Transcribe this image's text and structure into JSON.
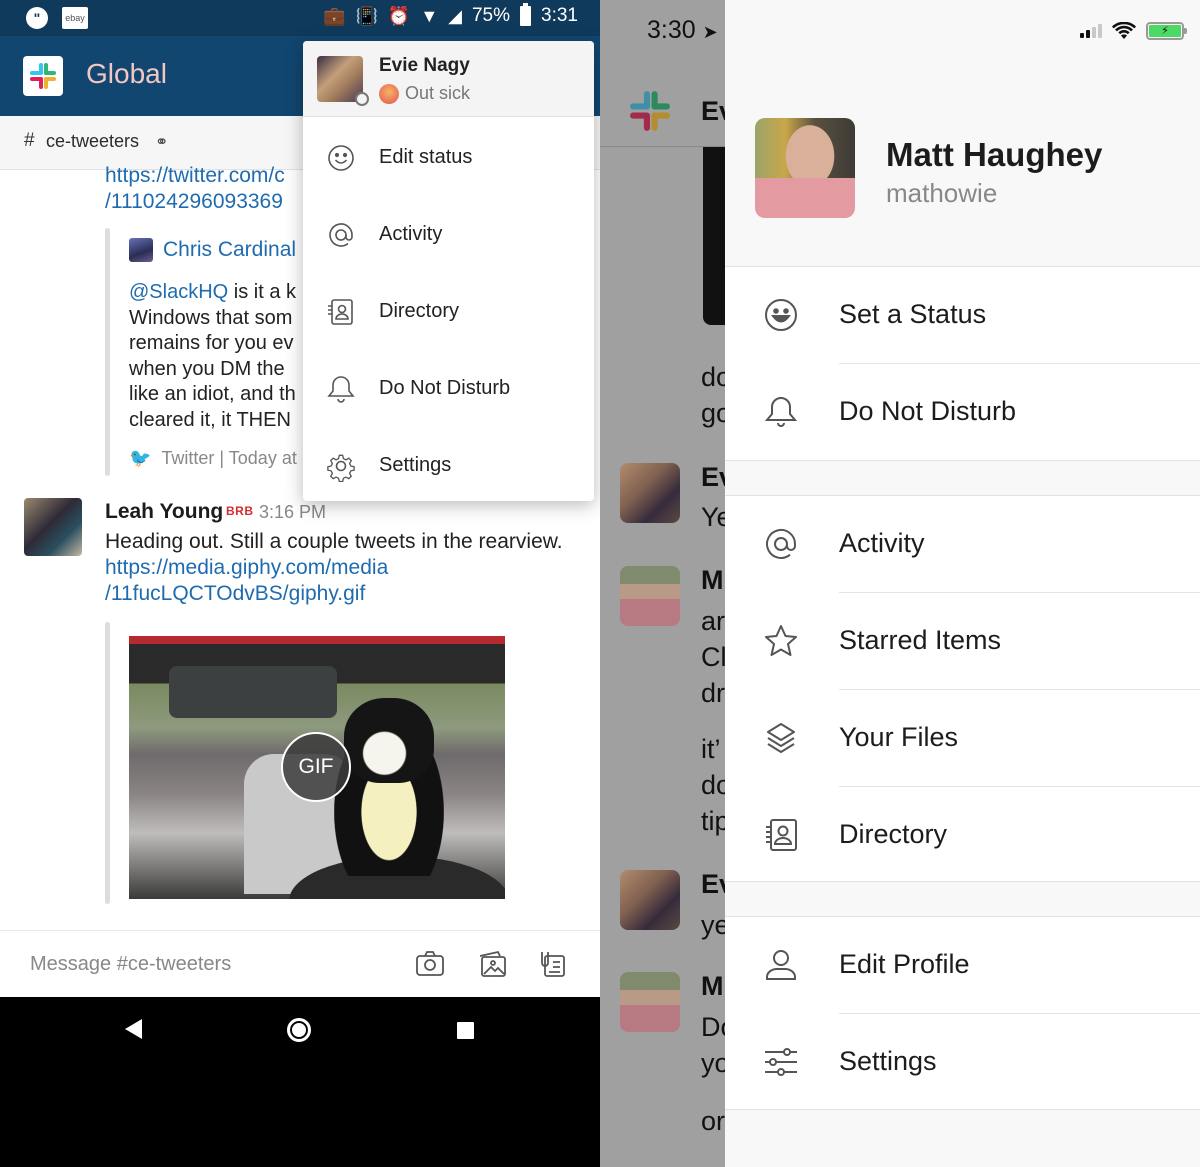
{
  "android": {
    "status_bar": {
      "left_icons": [
        "hangouts-icon",
        "ebay-icon"
      ],
      "ebay_label": "ebay",
      "battery": "75%",
      "time": "3:31",
      "icons": [
        "briefcase-icon",
        "vibrate-icon",
        "alarm-icon",
        "wifi-icon",
        "signal-icon",
        "battery-icon"
      ]
    },
    "header": {
      "workspace": "Global"
    },
    "channel": {
      "hash": "#",
      "name": "ce-tweeters",
      "shared_icon": "⚭"
    },
    "messages": {
      "link_line_1": "https://twitter.com/c",
      "link_line_2": "/111024296093369",
      "tweet": {
        "author": "Chris Cardinal",
        "mention": "@SlackHQ",
        "lines": [
          " is it a k",
          "Windows that som",
          "remains for you ev",
          "when you DM the",
          "like an idiot, and th",
          "cleared it, it THEN"
        ],
        "footer": "Twitter | Today at"
      },
      "leah": {
        "name": "Leah Young",
        "badge": "BRB",
        "time": "3:16 PM",
        "text": "Heading out. Still a couple tweets in the rearview.",
        "link_line_1": "https://media.giphy.com/media",
        "link_line_2": "/11fucLQCTOdvBS/giphy.gif",
        "gif_badge": "GIF"
      }
    },
    "composer": {
      "placeholder": "Message #ce-tweeters"
    },
    "popup": {
      "user_name": "Evie Nagy",
      "status_text": "Out sick",
      "items": [
        {
          "label": "Edit status",
          "icon": "smiley-icon"
        },
        {
          "label": "Activity",
          "icon": "at-icon"
        },
        {
          "label": "Directory",
          "icon": "directory-icon"
        },
        {
          "label": "Do Not Disturb",
          "icon": "bell-icon"
        },
        {
          "label": "Settings",
          "icon": "gear-icon"
        }
      ]
    }
  },
  "ios": {
    "status_bar": {
      "time": "3:30",
      "location_arrow": "➤"
    },
    "background": {
      "header_initials": "Ev",
      "fragments": [
        "do",
        "go",
        "Ev",
        "Ye",
        "M",
        "ar",
        "Cl",
        "dr",
        "it’",
        "do",
        "tip",
        "Ev",
        "ye",
        "M",
        "Do",
        "yo",
        "or"
      ]
    },
    "drawer": {
      "user_name": "Matt Haughey",
      "handle": "mathowie",
      "groups": [
        [
          {
            "label": "Set a Status",
            "icon": "smiley-icon"
          },
          {
            "label": "Do Not Disturb",
            "icon": "bell-icon"
          }
        ],
        [
          {
            "label": "Activity",
            "icon": "at-icon"
          },
          {
            "label": "Starred Items",
            "icon": "star-icon"
          },
          {
            "label": "Your Files",
            "icon": "layers-icon"
          },
          {
            "label": "Directory",
            "icon": "directory-icon"
          }
        ],
        [
          {
            "label": "Edit Profile",
            "icon": "person-icon"
          },
          {
            "label": "Settings",
            "icon": "sliders-icon"
          }
        ]
      ]
    }
  },
  "colors": {
    "android_status": "#0f3a5c",
    "android_header": "#114670",
    "workspace_title": "#f2c7c4",
    "link": "#1f6bb0",
    "brb": "#d62d2d",
    "ios_battery": "#4cd964"
  }
}
